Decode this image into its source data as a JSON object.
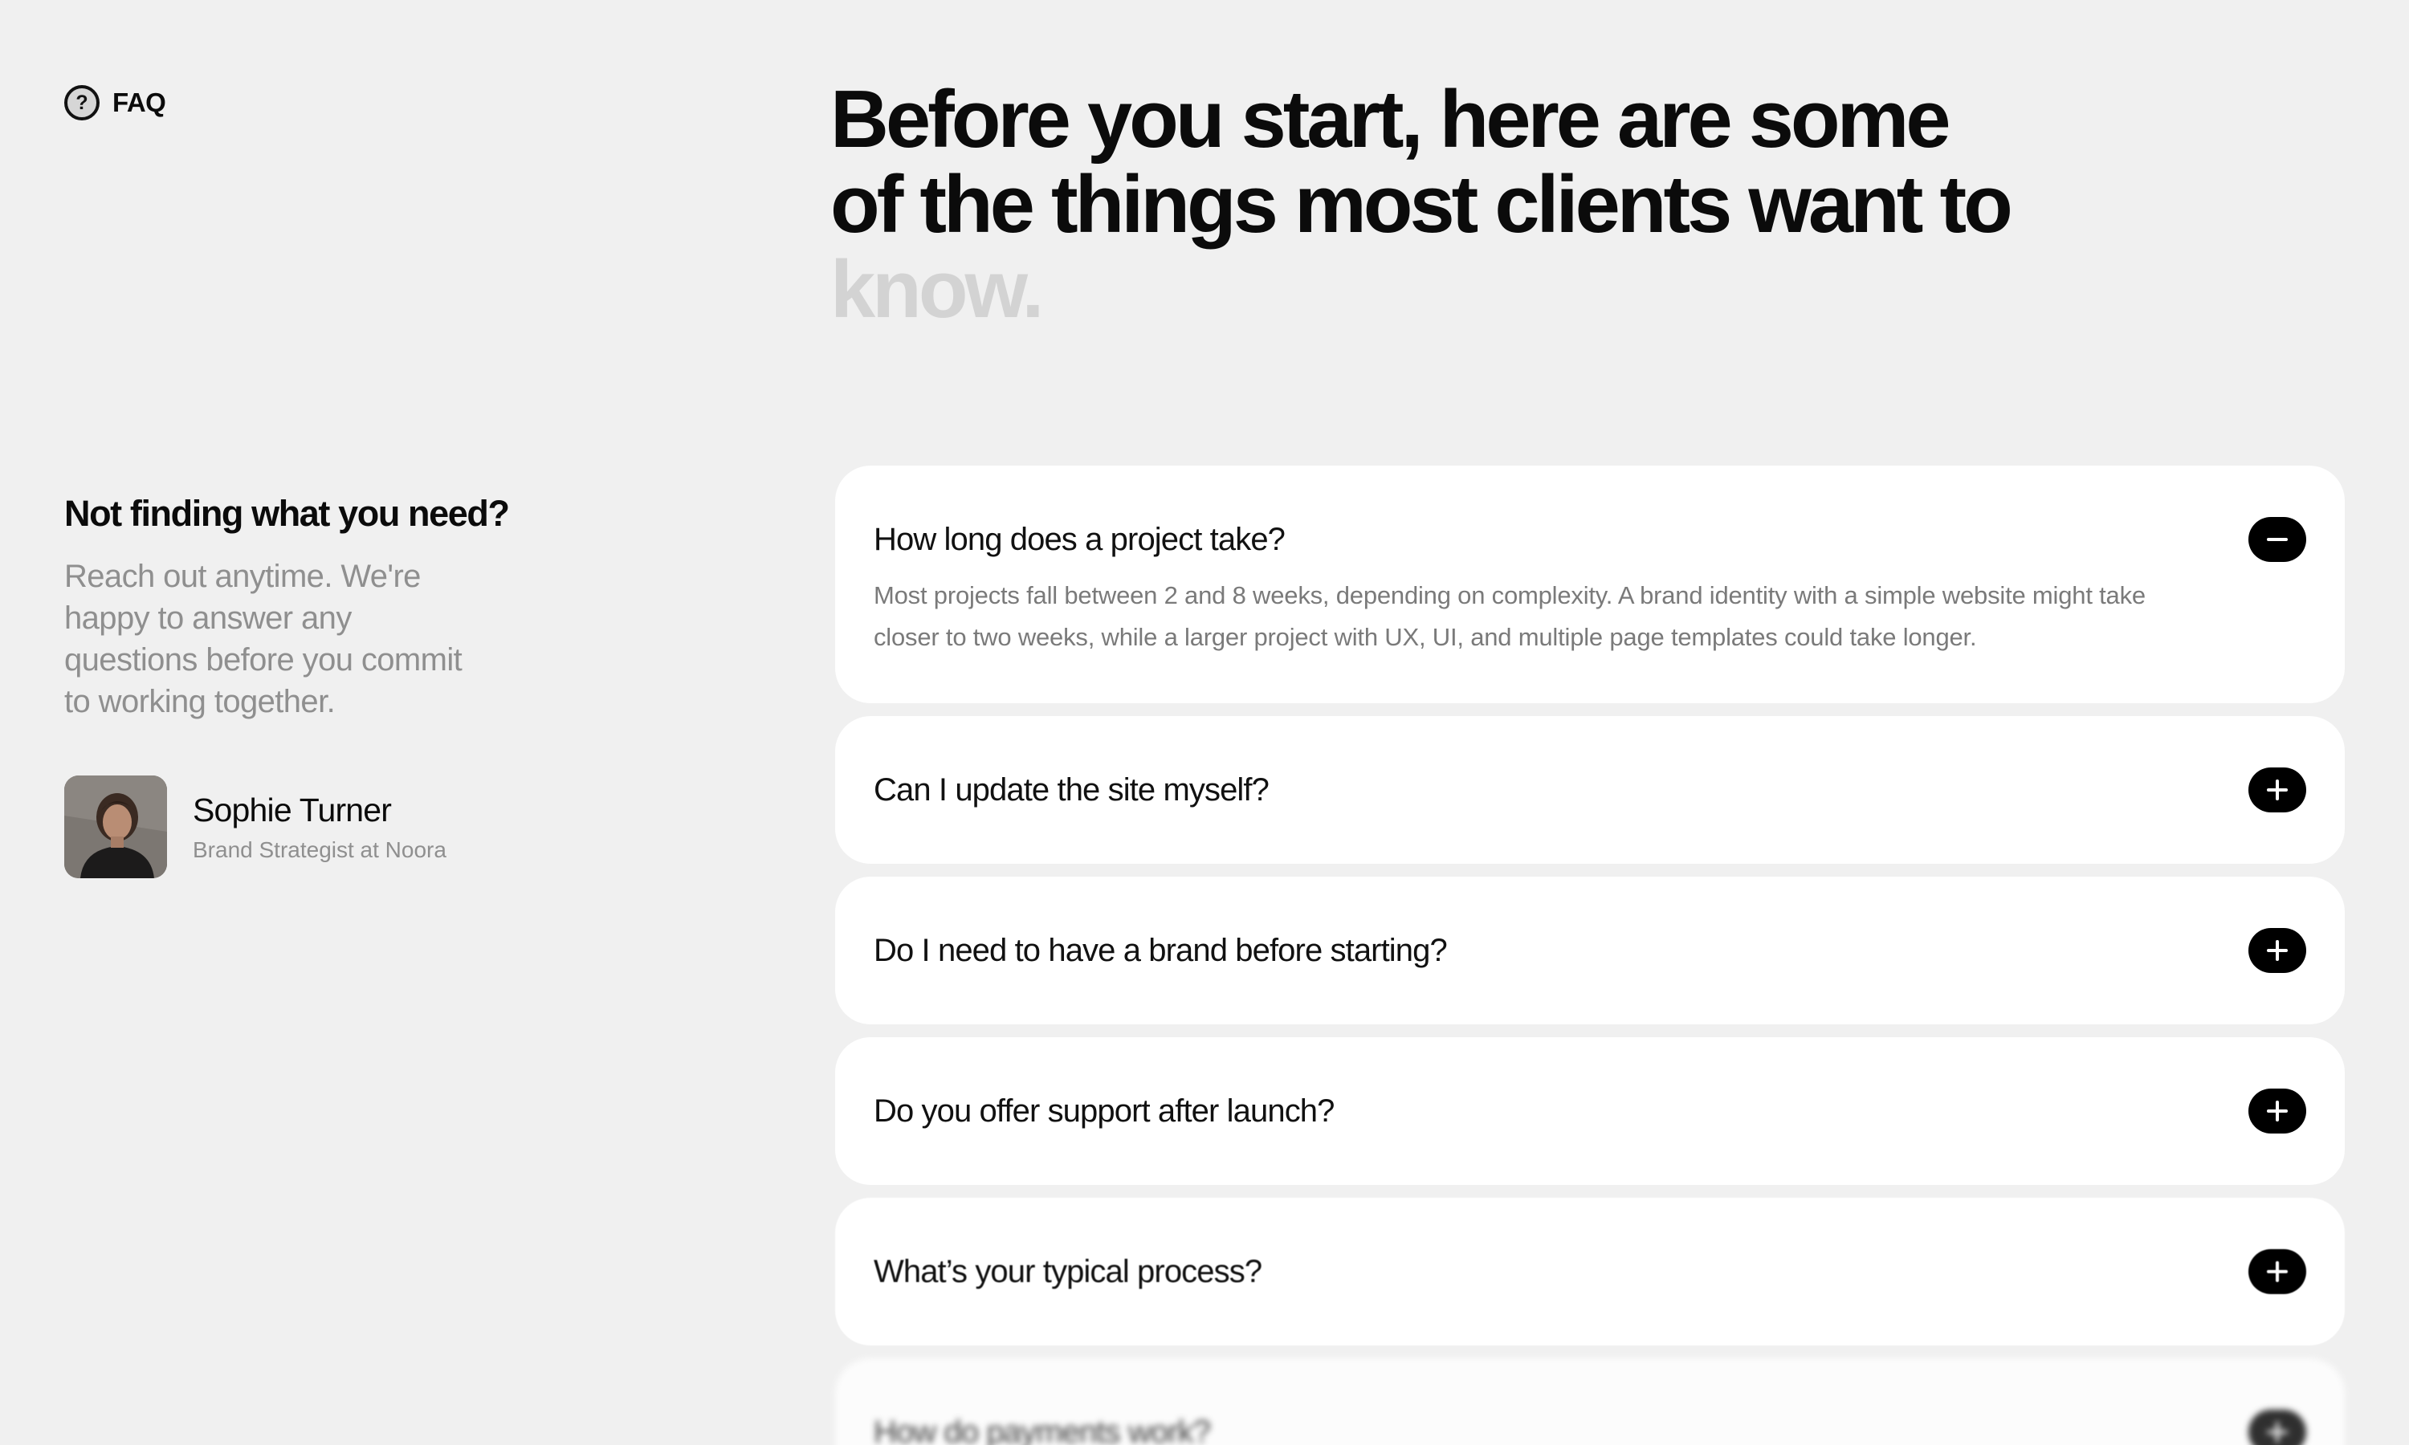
{
  "section_tag": {
    "icon": "question-circle-icon",
    "label": "FAQ"
  },
  "heading": {
    "line_main": "Before you start, here are some of the things most clients want to",
    "line_faded": "know."
  },
  "help": {
    "title": "Not finding what you need?",
    "text": "Reach out anytime. We're happy to answer any questions before you commit to working together."
  },
  "person": {
    "name": "Sophie Turner",
    "role": "Brand Strategist at Noora"
  },
  "faqs": [
    {
      "question": "How long does a project take?",
      "answer": "Most projects fall between 2 and 8 weeks, depending on complexity. A brand identity with a simple website might take closer to two weeks, while a larger project with UX, UI, and multiple page templates could take longer.",
      "expanded": true
    },
    {
      "question": "Can I update the site myself?",
      "expanded": false
    },
    {
      "question": "Do I need to have a brand before starting?",
      "expanded": false
    },
    {
      "question": "Do you offer support after launch?",
      "expanded": false
    },
    {
      "question": "What’s your typical process?",
      "expanded": false
    },
    {
      "question": "How do payments work?",
      "expanded": false
    }
  ],
  "colors": {
    "background": "#f0f0f0",
    "card": "#ffffff",
    "toggle": "#000000",
    "muted_text": "#8f8f8f",
    "faded_heading": "#d3d3d3"
  }
}
